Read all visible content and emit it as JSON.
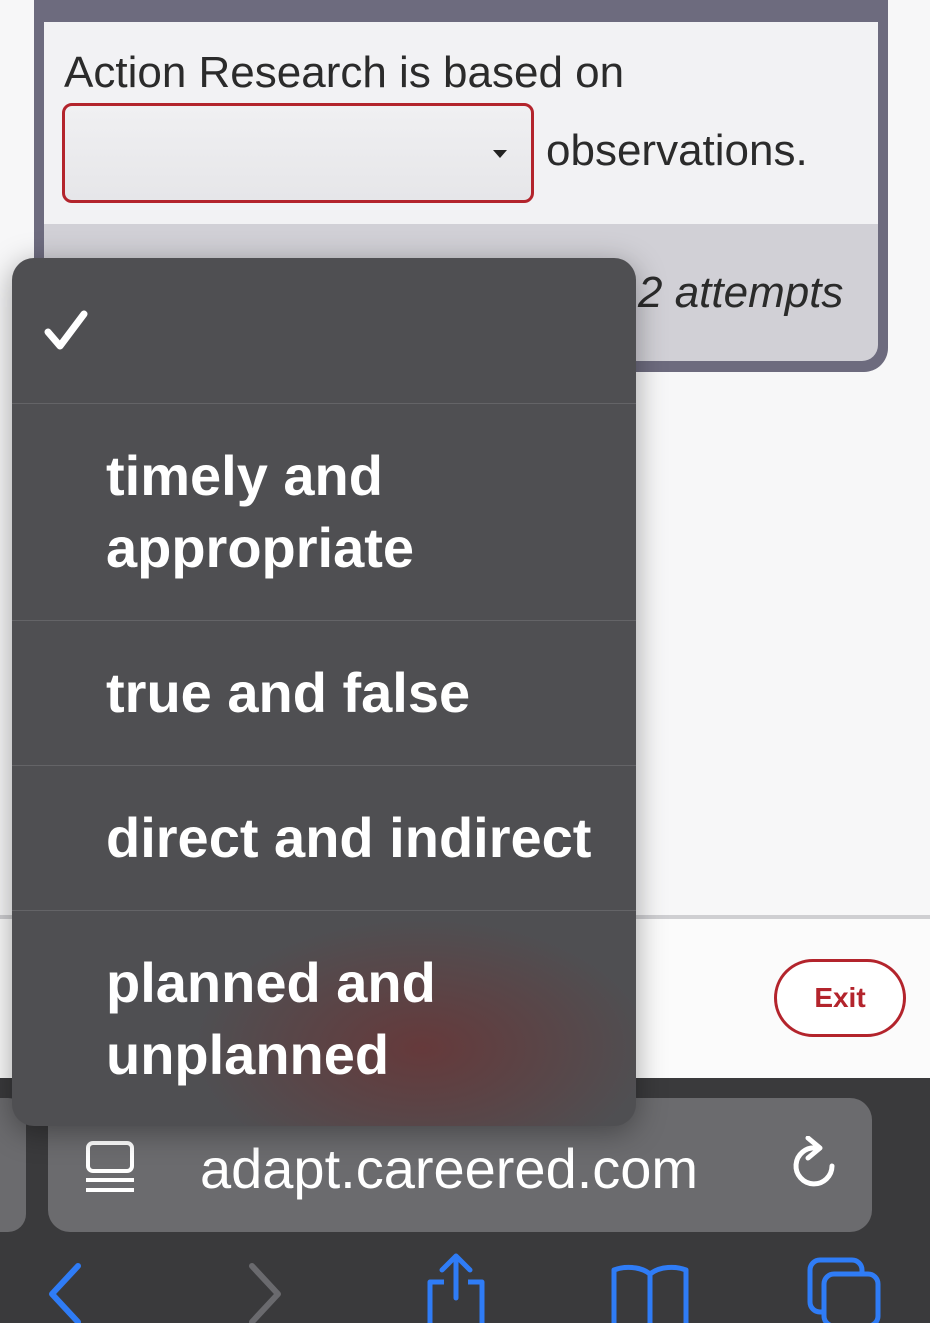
{
  "question": {
    "prefix": "Action Research is based on",
    "suffix": "observations.",
    "selected_value": "",
    "attempts_text": "2 attempts"
  },
  "dropdown": {
    "options": [
      {
        "label": "",
        "selected": true
      },
      {
        "label": "timely and appropriate",
        "selected": false
      },
      {
        "label": "true and false",
        "selected": false
      },
      {
        "label": "direct and indirect",
        "selected": false
      },
      {
        "label": "planned and unplanned",
        "selected": false
      }
    ]
  },
  "footer": {
    "exit_label": "Exit"
  },
  "browser": {
    "url": "adapt.careered.com"
  },
  "colors": {
    "accent_red": "#b3242c",
    "ios_blue": "#2f7cf6",
    "menu_bg": "#4f4f52"
  },
  "icons": [
    "checkmark-icon",
    "select-arrow-icon",
    "reader-mode-icon",
    "reload-icon",
    "back-icon",
    "forward-icon",
    "share-icon",
    "bookmarks-icon",
    "tabs-icon"
  ]
}
